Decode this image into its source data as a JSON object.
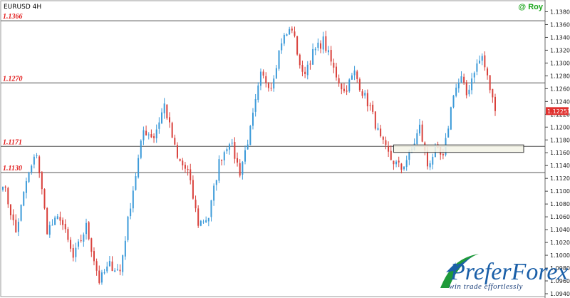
{
  "chart_data": {
    "type": "candlestick",
    "title": "EURUSD 4H",
    "author": "@ Roy",
    "current_price_label": "1.12253",
    "ylim": [
      1.094,
      1.1395
    ],
    "y_ticks": [
      "1.13800",
      "1.13600",
      "1.13400",
      "1.13200",
      "1.13000",
      "1.12800",
      "1.12600",
      "1.12400",
      "1.12200",
      "1.12000",
      "1.11800",
      "1.11600",
      "1.11400",
      "1.11200",
      "1.11000",
      "1.10800",
      "1.10600",
      "1.10400",
      "1.10200",
      "1.10000",
      "1.09800",
      "1.09600",
      "1.09400"
    ],
    "levels": [
      {
        "label": "1.1366",
        "value": 1.1366
      },
      {
        "label": "1.1270",
        "value": 1.1269
      },
      {
        "label": "1.1171",
        "value": 1.117
      },
      {
        "label": "1.1130",
        "value": 1.1129
      }
    ],
    "zone": {
      "from": 1.1165,
      "to": 1.117
    },
    "anchors": [
      [
        0,
        1.1115
      ],
      [
        5,
        1.1035
      ],
      [
        9,
        1.1115
      ],
      [
        13,
        1.116
      ],
      [
        17,
        1.104
      ],
      [
        22,
        1.106
      ],
      [
        27,
        1.0995
      ],
      [
        32,
        1.1045
      ],
      [
        37,
        1.096
      ],
      [
        41,
        1.0985
      ],
      [
        45,
        1.0975
      ],
      [
        49,
        1.108
      ],
      [
        54,
        1.1195
      ],
      [
        58,
        1.1185
      ],
      [
        62,
        1.1235
      ],
      [
        67,
        1.115
      ],
      [
        71,
        1.113
      ],
      [
        75,
        1.105
      ],
      [
        79,
        1.106
      ],
      [
        83,
        1.1145
      ],
      [
        87,
        1.118
      ],
      [
        91,
        1.113
      ],
      [
        95,
        1.1195
      ],
      [
        99,
        1.128
      ],
      [
        103,
        1.1265
      ],
      [
        107,
        1.1335
      ],
      [
        111,
        1.1355
      ],
      [
        115,
        1.128
      ],
      [
        119,
        1.1315
      ],
      [
        123,
        1.1335
      ],
      [
        127,
        1.129
      ],
      [
        131,
        1.1255
      ],
      [
        135,
        1.1285
      ],
      [
        138,
        1.1255
      ],
      [
        141,
        1.123
      ],
      [
        145,
        1.118
      ],
      [
        149,
        1.115
      ],
      [
        153,
        1.1135
      ],
      [
        157,
        1.1165
      ],
      [
        160,
        1.12
      ],
      [
        163,
        1.114
      ],
      [
        166,
        1.1165
      ],
      [
        169,
        1.115
      ],
      [
        173,
        1.1255
      ],
      [
        176,
        1.1275
      ],
      [
        178,
        1.125
      ],
      [
        181,
        1.129
      ],
      [
        184,
        1.131
      ],
      [
        187,
        1.126
      ],
      [
        189,
        1.1225
      ]
    ]
  },
  "brand": {
    "logo_text": "PreferForex",
    "tagline": "win trade effortlessly"
  },
  "colors": {
    "bull": "#3b9ad9",
    "bear": "#d9403b",
    "grid": "#d8d8d8",
    "level_line": "#555555",
    "price_tag_bg": "#e0302e",
    "level_label": "#e11b1b",
    "author": "#19a51a"
  }
}
